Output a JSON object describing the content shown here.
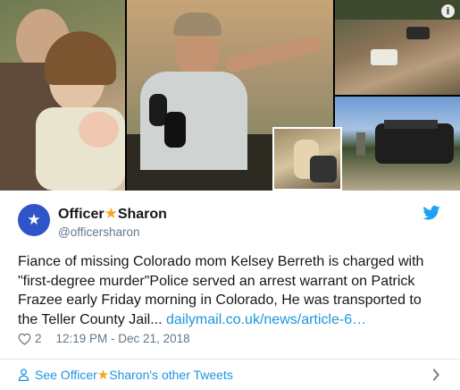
{
  "media": {
    "info_icon": "i"
  },
  "author": {
    "name_part1": "Officer",
    "name_star": "★",
    "name_part2": "Sharon",
    "handle": "@officersharon",
    "avatar_glyph": "★",
    "avatar_color": "#2f54c9"
  },
  "tweet": {
    "text_line1": "Fiance of missing Colorado mom Kelsey Berreth is charged with",
    "text_line2": "\"first-degree murder\"Police served an arrest warrant on Patrick",
    "text_line3": "Frazee early Friday morning in Colorado, He was transported to",
    "text_line4_prefix": "the Teller County Jail... ",
    "link_text": "dailymail.co.uk/news/article-6…"
  },
  "meta": {
    "likes": "2",
    "timestamp": "12:19 PM - Dec 21, 2018"
  },
  "footer": {
    "prefix": "See Officer",
    "star": "★",
    "suffix": "Sharon's other Tweets"
  },
  "colors": {
    "link": "#1b95e0",
    "secondary_text": "#657786",
    "star": "#f5a623",
    "divider": "#e1e8ed"
  }
}
